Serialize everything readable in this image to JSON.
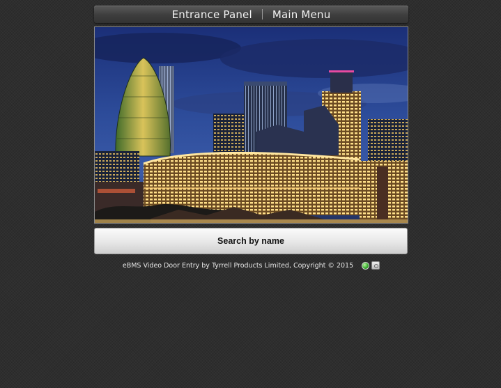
{
  "header": {
    "left_title": "Entrance Panel",
    "right_title": "Main Menu"
  },
  "hero": {
    "image_name": "city-skyline-night-photo"
  },
  "search": {
    "label": "Search by name"
  },
  "footer": {
    "copyright": "eBMS Video Door Entry by Tyrrell Products Limited, Copyright © 2015",
    "status_icon": "status-green-dot-icon",
    "settings_icon": "settings-icon"
  },
  "colors": {
    "background": "#2e2e2e",
    "header_text": "#f2f2f2",
    "button_text": "#111111",
    "status_green": "#33a82a"
  }
}
